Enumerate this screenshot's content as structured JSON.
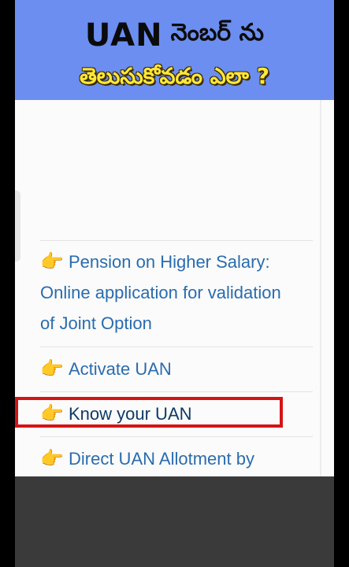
{
  "banner": {
    "title_en": "UAN",
    "title_te": "నెంబర్ ను",
    "subtitle_te": "తెలుసుకోవడం ఎలా ?"
  },
  "menu": {
    "items": [
      {
        "label_lines": [
          "Pension on Higher Salary:",
          "Online application for validation",
          "of Joint Option"
        ],
        "icon": "thumbs-up-icon"
      },
      {
        "label": "Activate UAN",
        "icon": "thumbs-up-icon"
      },
      {
        "label": "Know your UAN",
        "icon": "thumbs-up-icon",
        "highlighted": true
      },
      {
        "label": "Direct UAN Allotment by",
        "icon": "thumbs-up-icon"
      }
    ]
  },
  "colors": {
    "banner_bg": "#6b8ef0",
    "link_blue": "#2a6cae",
    "icon_orange": "#f08a1c",
    "highlight_red": "#d41414"
  }
}
